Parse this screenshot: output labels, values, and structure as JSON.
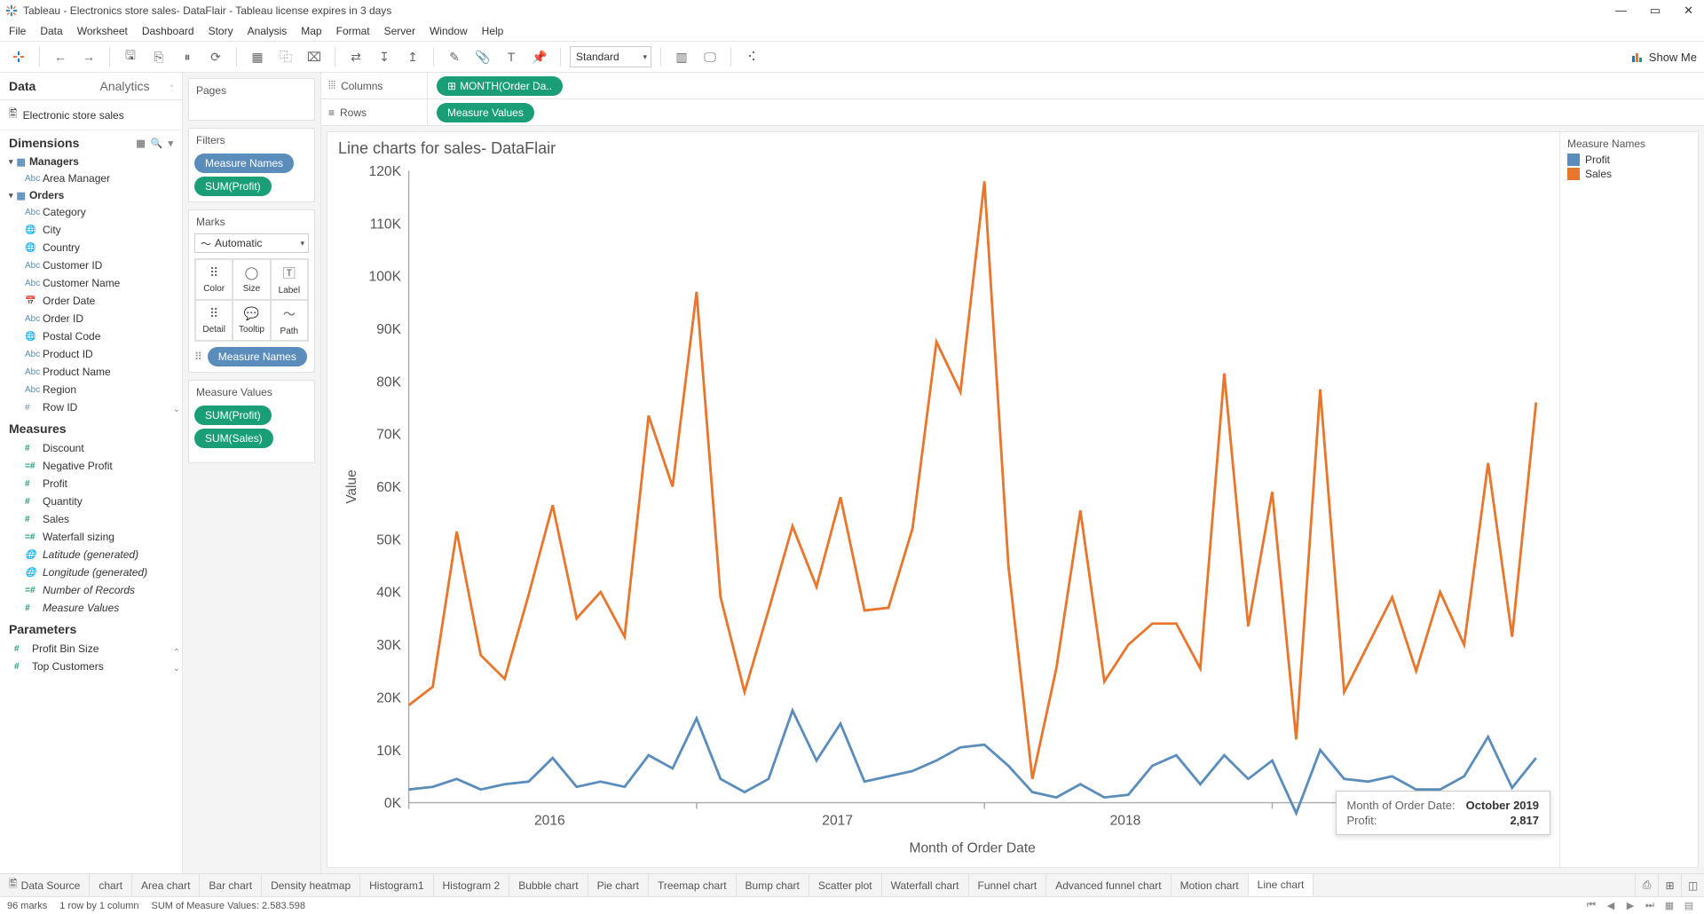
{
  "window": {
    "title": "Tableau - Electronics store sales- DataFlair - Tableau license expires in 3 days"
  },
  "menu": [
    "File",
    "Data",
    "Worksheet",
    "Dashboard",
    "Story",
    "Analysis",
    "Map",
    "Format",
    "Server",
    "Window",
    "Help"
  ],
  "toolbar": {
    "fit": "Standard",
    "showme": "Show Me"
  },
  "datapane": {
    "tabs": {
      "data": "Data",
      "analytics": "Analytics"
    },
    "datasource": "Electronic store sales",
    "sections": {
      "dimensions": "Dimensions",
      "measures": "Measures",
      "parameters": "Parameters"
    },
    "groups": {
      "managers": "Managers",
      "orders": "Orders"
    },
    "dim_managers": [
      "Area Manager"
    ],
    "dim_orders": [
      "Category",
      "City",
      "Country",
      "Customer ID",
      "Customer Name",
      "Order Date",
      "Order ID",
      "Postal Code",
      "Product ID",
      "Product Name",
      "Region",
      "Row ID"
    ],
    "measures": [
      "Discount",
      "Negative Profit",
      "Profit",
      "Quantity",
      "Sales",
      "Waterfall sizing",
      "Latitude (generated)",
      "Longitude (generated)",
      "Number of Records",
      "Measure Values"
    ],
    "parameters": [
      "Profit Bin Size",
      "Top Customers"
    ]
  },
  "shelves": {
    "pages": "Pages",
    "filters": "Filters",
    "filter_pills": [
      "Measure Names",
      "SUM(Profit)"
    ],
    "marks": "Marks",
    "mark_type": "Automatic",
    "mark_cells": [
      "Color",
      "Size",
      "Label",
      "Detail",
      "Tooltip",
      "Path"
    ],
    "color_pill": "Measure Names",
    "mv_title": "Measure Values",
    "mv_pills": [
      "SUM(Profit)",
      "SUM(Sales)"
    ],
    "columns": "Columns",
    "rows": "Rows",
    "col_pill": "MONTH(Order Da..",
    "row_pill": "Measure Values"
  },
  "viz": {
    "title": "Line charts for sales- DataFlair",
    "xlabel": "Month of Order Date",
    "ylabel": "Value",
    "legend_title": "Measure Names",
    "legend": [
      "Profit",
      "Sales"
    ],
    "colors": {
      "profit": "#5b8dbc",
      "sales": "#e8762c"
    }
  },
  "tooltip": {
    "k1": "Month of Order Date:",
    "v1": "October 2019",
    "k2": "Profit:",
    "v2": "2,817"
  },
  "tabs": [
    "Data Source",
    "chart",
    "Area chart",
    "Bar chart",
    "Density heatmap",
    "Histogram1",
    "Histogram 2",
    "Bubble chart",
    "Pie chart",
    "Treemap chart",
    "Bump chart",
    "Scatter plot",
    "Waterfall chart",
    "Funnel chart",
    "Advanced funnel chart",
    "Motion chart",
    "Line chart"
  ],
  "status": {
    "marks": "96 marks",
    "rows": "1 row by 1 column",
    "sum": "SUM of Measure Values: 2.583.598"
  },
  "chart_data": {
    "type": "line",
    "title": "Line charts for sales- DataFlair",
    "xlabel": "Month of Order Date",
    "ylabel": "Value",
    "ylim": [
      0,
      120000
    ],
    "year_ticks": [
      "2016",
      "2017",
      "2018",
      "2019"
    ],
    "x_months": [
      "2016-01",
      "2016-02",
      "2016-03",
      "2016-04",
      "2016-05",
      "2016-06",
      "2016-07",
      "2016-08",
      "2016-09",
      "2016-10",
      "2016-11",
      "2016-12",
      "2017-01",
      "2017-02",
      "2017-03",
      "2017-04",
      "2017-05",
      "2017-06",
      "2017-07",
      "2017-08",
      "2017-09",
      "2017-10",
      "2017-11",
      "2017-12",
      "2018-01",
      "2018-02",
      "2018-03",
      "2018-04",
      "2018-05",
      "2018-06",
      "2018-07",
      "2018-08",
      "2018-09",
      "2018-10",
      "2018-11",
      "2018-12",
      "2019-01",
      "2019-02",
      "2019-03",
      "2019-04",
      "2019-05",
      "2019-06",
      "2019-07",
      "2019-08",
      "2019-09",
      "2019-10",
      "2019-11",
      "2019-12"
    ],
    "series": [
      {
        "name": "Sales",
        "color": "#e8762c",
        "values": [
          18500,
          22000,
          51500,
          28000,
          23500,
          39500,
          56500,
          35000,
          40000,
          31500,
          73500,
          60000,
          97000,
          39000,
          21000,
          36500,
          52500,
          41000,
          58000,
          36500,
          37000,
          52000,
          87500,
          78000,
          118000,
          45000,
          4500,
          25500,
          55500,
          23000,
          30000,
          34000,
          34000,
          25500,
          81500,
          33500,
          59000,
          12000,
          78500,
          21000,
          30000,
          39000,
          25000,
          40000,
          30000,
          64500,
          31500,
          76000
        ]
      },
      {
        "name": "Profit",
        "color": "#5b8dbc",
        "values": [
          2500,
          3000,
          4500,
          2500,
          3500,
          4000,
          8500,
          3000,
          4000,
          3000,
          9000,
          6500,
          16000,
          4500,
          2000,
          4500,
          17500,
          8000,
          15000,
          4000,
          5000,
          6000,
          8000,
          10500,
          11000,
          7000,
          2000,
          1000,
          3500,
          1000,
          1500,
          7000,
          9000,
          3500,
          9000,
          4500,
          8000,
          -2000,
          10000,
          4500,
          4000,
          5000,
          2500,
          2500,
          5000,
          12500,
          2817,
          8500
        ]
      }
    ]
  }
}
